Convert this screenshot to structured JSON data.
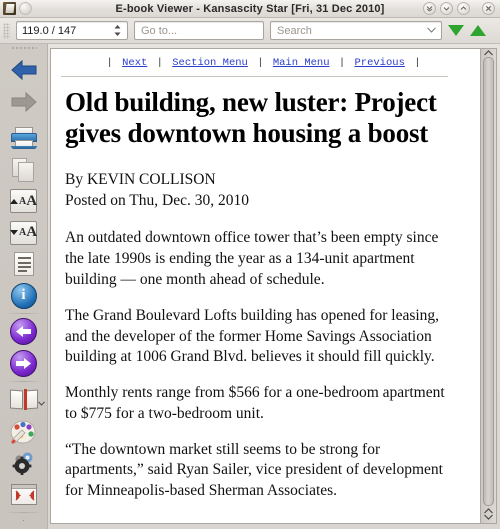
{
  "window": {
    "title": "E-book Viewer - Kansascity Star [Fri, 31 Dec 2010]",
    "app_icon": "book-icon",
    "buttons": {
      "shade": "shade-window-button",
      "minimize": "minimize-window-button",
      "maximize": "maximize-window-button",
      "close": "close-window-button"
    }
  },
  "toolbar": {
    "position_value": "119.0 / 147",
    "goto_placeholder": "Go to...",
    "search_placeholder": "Search",
    "search_value": "",
    "find_next_label": "find-next",
    "find_previous_label": "find-previous",
    "accent_green": "#2fa52f"
  },
  "sidebar": {
    "items": [
      {
        "name": "back-button",
        "icon": "left-arrow-icon",
        "enabled": true
      },
      {
        "name": "forward-button",
        "icon": "right-arrow-icon",
        "enabled": false
      },
      {
        "name": "print-button",
        "icon": "printer-icon"
      },
      {
        "name": "copy-button",
        "icon": "copy-pages-icon"
      },
      {
        "name": "increase-font-size-button",
        "icon": "font-larger-icon"
      },
      {
        "name": "decrease-font-size-button",
        "icon": "font-smaller-icon"
      },
      {
        "name": "table-of-contents-button",
        "icon": "document-lines-icon"
      },
      {
        "name": "metadata-button",
        "icon": "info-icon"
      },
      {
        "name": "previous-page-button",
        "icon": "circle-left-arrow-icon"
      },
      {
        "name": "next-page-button",
        "icon": "circle-right-arrow-icon"
      },
      {
        "name": "bookmarks-button",
        "icon": "open-book-icon",
        "has_menu": true
      },
      {
        "name": "preferences-colors-button",
        "icon": "palette-icon"
      },
      {
        "name": "settings-button",
        "icon": "gear-icon"
      },
      {
        "name": "fullscreen-button",
        "icon": "fullscreen-icon"
      }
    ]
  },
  "document": {
    "nav_links": [
      {
        "label": "Next"
      },
      {
        "label": "Section Menu"
      },
      {
        "label": "Main Menu"
      },
      {
        "label": "Previous"
      }
    ],
    "headline": "Old building, new luster: Project gives downtown housing a boost",
    "author": "By KEVIN COLLISON",
    "posted": "Posted on Thu, Dec. 30, 2010",
    "paragraphs": [
      "An outdated downtown office tower that’s been empty since the late 1990s is ending the year as a 134-unit apartment building — one month ahead of schedule.",
      "The Grand Boulevard Lofts building has opened for leasing, and the developer of the former Home Savings Association building at 1006 Grand Blvd. believes it should fill quickly.",
      "Monthly rents range from $566 for a one-bedroom apartment to $775 for a two-bedroom unit.",
      "“The downtown market still seems to be strong for apartments,” said Ryan Sailer, vice president of development for Minneapolis-based Sherman Associates."
    ]
  },
  "scrollbar": {
    "up_arrow": "scroll-up-arrow",
    "down_arrow": "scroll-down-arrow"
  }
}
